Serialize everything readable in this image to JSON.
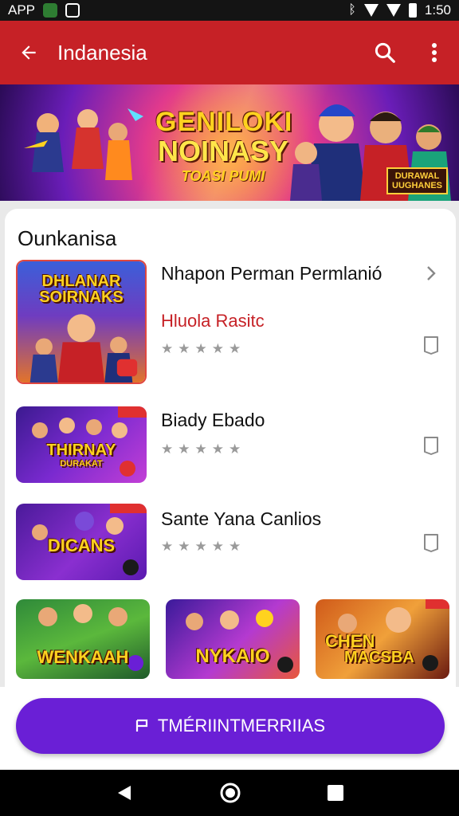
{
  "status_bar": {
    "app_label": "APP",
    "time": "1:50"
  },
  "app_bar": {
    "title": "Indanesia"
  },
  "banner": {
    "line1": "GENILOKI",
    "line2": "NOINASY",
    "line3": "TOASI PUMI",
    "corner_tag_line1": "DURAWAL",
    "corner_tag_line2": "UUGHANES"
  },
  "section": {
    "title": "Ounkanisa"
  },
  "items": [
    {
      "name": "Nhapon Perman Permlanió",
      "subtitle": "Hluola Rasitc",
      "thumb_line1": "DHLANAR",
      "thumb_line2": "SOIRNAKS",
      "rating": 0
    },
    {
      "name": "Biady Ebado",
      "thumb_line1": "THIRNAY",
      "thumb_line2": "DURAKAT",
      "rating": 0
    },
    {
      "name": "Sante Yana Canlios",
      "thumb_line1": "DICANS",
      "rating": 0
    }
  ],
  "grid_tiles": [
    {
      "label": "WENKAAH"
    },
    {
      "label": "NYKAIO"
    },
    {
      "label_line1": "CHEN",
      "label_line2": "MACSBA"
    }
  ],
  "cta": {
    "label": "TMÉRIINTMERRIIAS"
  },
  "colors": {
    "app_bar": "#c62126",
    "accent_text": "#c62126",
    "cta": "#6a1fd6"
  }
}
